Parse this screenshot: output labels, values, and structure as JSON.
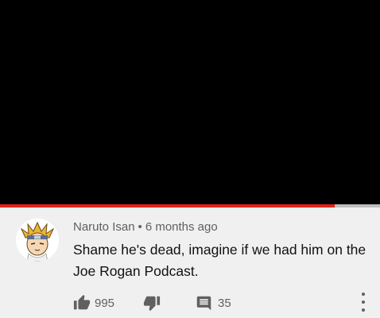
{
  "player": {
    "progress_fraction": 0.88,
    "progress_color": "#e62117"
  },
  "comment": {
    "author": "Naruto Isan",
    "separator": "•",
    "timestamp": "6 months ago",
    "text": "Shame he's dead, imagine if we had him on the Joe Rogan Podcast.",
    "like_count": "995",
    "reply_count": "35",
    "icons": [
      "thumbs-up-icon",
      "thumbs-down-icon",
      "reply-icon",
      "more-vert-icon"
    ]
  }
}
